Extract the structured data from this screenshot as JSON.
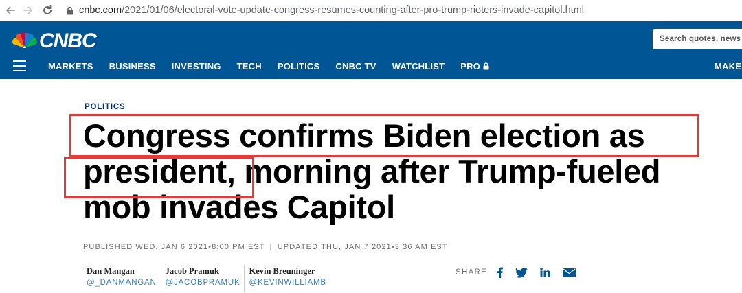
{
  "browser": {
    "url_host": "cnbc.com",
    "url_path": "/2021/01/06/electoral-vote-update-congress-resumes-counting-after-pro-trump-rioters-invade-capitol.html"
  },
  "header": {
    "logo_text": "CNBC",
    "search_placeholder": "Search quotes, news",
    "nav_items": [
      "MARKETS",
      "BUSINESS",
      "INVESTING",
      "TECH",
      "POLITICS",
      "CNBC TV",
      "WATCHLIST",
      "PRO"
    ],
    "make_it_label": "MAKE IT",
    "brand_color": "#005594"
  },
  "article": {
    "section": "POLITICS",
    "headline_lines": [
      "Congress confirms Biden election as",
      "president, morning after Trump-fueled",
      "mob invades Capitol"
    ],
    "published": "PUBLISHED WED, JAN 6 2021•8:00 PM EST",
    "updated": "UPDATED THU, JAN 7 2021•3:36 AM EST",
    "timestamp_separator": "|",
    "authors": [
      {
        "name": "Dan Mangan",
        "handle": "@_DANMANGAN"
      },
      {
        "name": "Jacob Pramuk",
        "handle": "@JACOBPRAMUK"
      },
      {
        "name": "Kevin Breuninger",
        "handle": "@KEVINWILLIAMB"
      }
    ],
    "share_label": "SHARE",
    "share_icons": [
      "facebook-icon",
      "twitter-icon",
      "linkedin-icon",
      "email-icon"
    ],
    "highlight_color": "#e03c3c"
  }
}
